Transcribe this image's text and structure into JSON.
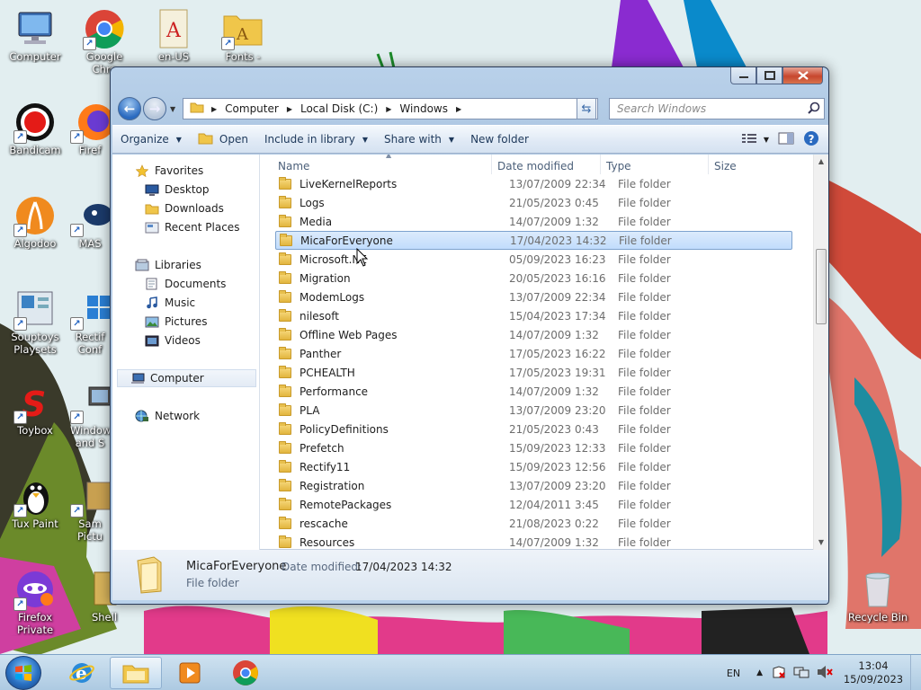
{
  "desktop": {
    "icons": [
      {
        "label": "Computer",
        "icon": "computer-icon",
        "shortcut": false
      },
      {
        "label": "Google\nChro",
        "icon": "chrome-icon",
        "shortcut": true
      },
      {
        "label": "en-US",
        "icon": "font-file-icon",
        "shortcut": false
      },
      {
        "label": "Fonts -",
        "icon": "fonts-folder-icon",
        "shortcut": true
      },
      {
        "label": "Bandicam",
        "icon": "bandicam-icon",
        "shortcut": true
      },
      {
        "label": "Firef",
        "icon": "firefox-icon",
        "shortcut": true
      },
      {
        "label": "Algodoo",
        "icon": "algodoo-icon",
        "shortcut": true
      },
      {
        "label": "MAS",
        "icon": "mas-icon",
        "shortcut": true
      },
      {
        "label": "Souptoys\nPlaysets",
        "icon": "souptoys-icon",
        "shortcut": true
      },
      {
        "label": "Rectif\nConf",
        "icon": "rectify-icon",
        "shortcut": true
      },
      {
        "label": "Toybox",
        "icon": "toybox-icon",
        "shortcut": true
      },
      {
        "label": "Window\nand S",
        "icon": "windows-icon",
        "shortcut": true
      },
      {
        "label": "Tux Paint",
        "icon": "tux-paint-icon",
        "shortcut": true
      },
      {
        "label": "Sam\nPictu",
        "icon": "pictures-icon",
        "shortcut": true
      },
      {
        "label": "Firefox Private\nBrowsing",
        "icon": "firefox-private-icon",
        "shortcut": true
      },
      {
        "label": "Shell",
        "icon": "shell-icon",
        "shortcut": false
      },
      {
        "label": "Recycle Bin",
        "icon": "recycle-bin-icon",
        "shortcut": false
      }
    ]
  },
  "explorer": {
    "breadcrumb": [
      "Computer",
      "Local Disk (C:)",
      "Windows"
    ],
    "search_placeholder": "Search Windows",
    "toolbar": {
      "organize": "Organize",
      "open": "Open",
      "include": "Include in library",
      "share": "Share with",
      "new_folder": "New folder"
    },
    "nav": {
      "favorites": "Favorites",
      "desktop": "Desktop",
      "downloads": "Downloads",
      "recent": "Recent Places",
      "libraries": "Libraries",
      "documents": "Documents",
      "music": "Music",
      "pictures": "Pictures",
      "videos": "Videos",
      "computer": "Computer",
      "network": "Network"
    },
    "columns": {
      "name": "Name",
      "date": "Date modified",
      "type": "Type",
      "size": "Size"
    },
    "files": [
      {
        "name": "LiveKernelReports",
        "date": "13/07/2009 22:34",
        "type": "File folder"
      },
      {
        "name": "Logs",
        "date": "21/05/2023 0:45",
        "type": "File folder"
      },
      {
        "name": "Media",
        "date": "14/07/2009 1:32",
        "type": "File folder"
      },
      {
        "name": "MicaForEveryone",
        "date": "17/04/2023 14:32",
        "type": "File folder",
        "selected": true
      },
      {
        "name": "Microsoft.NE",
        "date": "05/09/2023 16:23",
        "type": "File folder"
      },
      {
        "name": "Migration",
        "date": "20/05/2023 16:16",
        "type": "File folder"
      },
      {
        "name": "ModemLogs",
        "date": "13/07/2009 22:34",
        "type": "File folder"
      },
      {
        "name": "nilesoft",
        "date": "15/04/2023 17:34",
        "type": "File folder"
      },
      {
        "name": "Offline Web Pages",
        "date": "14/07/2009 1:32",
        "type": "File folder"
      },
      {
        "name": "Panther",
        "date": "17/05/2023 16:22",
        "type": "File folder"
      },
      {
        "name": "PCHEALTH",
        "date": "17/05/2023 19:31",
        "type": "File folder"
      },
      {
        "name": "Performance",
        "date": "14/07/2009 1:32",
        "type": "File folder"
      },
      {
        "name": "PLA",
        "date": "13/07/2009 23:20",
        "type": "File folder"
      },
      {
        "name": "PolicyDefinitions",
        "date": "21/05/2023 0:43",
        "type": "File folder"
      },
      {
        "name": "Prefetch",
        "date": "15/09/2023 12:33",
        "type": "File folder"
      },
      {
        "name": "Rectify11",
        "date": "15/09/2023 12:56",
        "type": "File folder"
      },
      {
        "name": "Registration",
        "date": "13/07/2009 23:20",
        "type": "File folder"
      },
      {
        "name": "RemotePackages",
        "date": "12/04/2011 3:45",
        "type": "File folder"
      },
      {
        "name": "rescache",
        "date": "21/08/2023 0:22",
        "type": "File folder"
      },
      {
        "name": "Resources",
        "date": "14/07/2009 1:32",
        "type": "File folder"
      }
    ],
    "details": {
      "name": "MicaForEveryone",
      "modified_label": "Date modified:",
      "modified_value": "17/04/2023 14:32",
      "type": "File folder"
    }
  },
  "taskbar": {
    "apps": [
      "ie-icon",
      "explorer-icon",
      "media-player-icon",
      "chrome-icon"
    ],
    "language": "EN",
    "time": "13:04",
    "date": "15/09/2023"
  }
}
